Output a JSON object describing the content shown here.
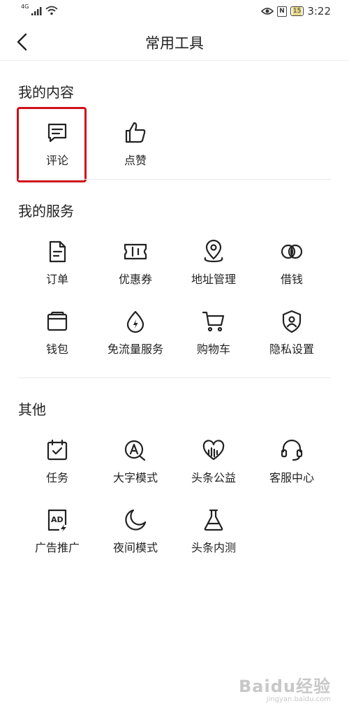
{
  "status_bar": {
    "network": "4G",
    "time": "3:22",
    "battery": "15"
  },
  "header": {
    "title": "常用工具"
  },
  "sections": [
    {
      "title": "我的内容",
      "items": [
        {
          "label": "评论",
          "icon": "comment-icon"
        },
        {
          "label": "点赞",
          "icon": "thumbs-up-icon"
        }
      ]
    },
    {
      "title": "我的服务",
      "items": [
        {
          "label": "订单",
          "icon": "order-icon"
        },
        {
          "label": "优惠券",
          "icon": "coupon-icon"
        },
        {
          "label": "地址管理",
          "icon": "location-pin-icon"
        },
        {
          "label": "借钱",
          "icon": "loan-icon"
        },
        {
          "label": "钱包",
          "icon": "wallet-icon"
        },
        {
          "label": "免流量服务",
          "icon": "free-data-icon"
        },
        {
          "label": "购物车",
          "icon": "shopping-cart-icon"
        },
        {
          "label": "隐私设置",
          "icon": "privacy-shield-icon"
        }
      ]
    },
    {
      "title": "其他",
      "items": [
        {
          "label": "任务",
          "icon": "task-calendar-icon"
        },
        {
          "label": "大字模式",
          "icon": "large-font-icon"
        },
        {
          "label": "头条公益",
          "icon": "charity-heart-icon"
        },
        {
          "label": "客服中心",
          "icon": "headset-icon"
        },
        {
          "label": "广告推广",
          "icon": "ad-icon"
        },
        {
          "label": "夜间模式",
          "icon": "moon-icon"
        },
        {
          "label": "头条内测",
          "icon": "flask-icon"
        }
      ]
    }
  ],
  "highlight": {
    "color": "#d0101a",
    "target": "评论"
  },
  "watermark": {
    "main": "Baidu经验",
    "sub": "jingyan.baidu.com"
  }
}
